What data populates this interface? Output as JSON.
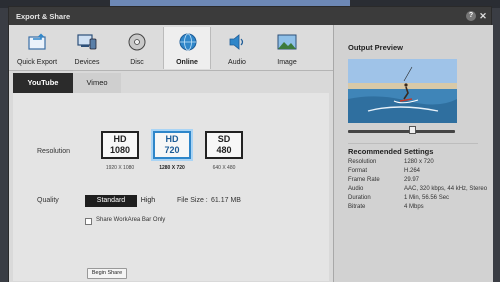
{
  "window": {
    "title": "Export & Share"
  },
  "titlebar": {
    "help_icon": "?",
    "close_icon": "✕"
  },
  "categories": [
    {
      "label": "Quick Export",
      "icon": "export-icon"
    },
    {
      "label": "Devices",
      "icon": "devices-icon"
    },
    {
      "label": "Disc",
      "icon": "disc-icon"
    },
    {
      "label": "Online",
      "icon": "globe-icon",
      "active": true
    },
    {
      "label": "Audio",
      "icon": "speaker-icon"
    },
    {
      "label": "Image",
      "icon": "image-icon"
    }
  ],
  "subtabs": [
    {
      "label": "YouTube",
      "active": true
    },
    {
      "label": "Vimeo"
    }
  ],
  "resolution": {
    "label": "Resolution",
    "options": [
      {
        "line1": "HD",
        "line2": "1080",
        "caption": "1920 X 1080"
      },
      {
        "line1": "HD",
        "line2": "720",
        "caption": "1280 X 720",
        "selected": true
      },
      {
        "line1": "SD",
        "line2": "480",
        "caption": "640 X 480"
      }
    ]
  },
  "quality": {
    "label": "Quality",
    "options": [
      "Standard",
      "High"
    ],
    "selected": "Standard",
    "file_size_label": "File Size :",
    "file_size_value": "61.17 MB"
  },
  "share_workarea": {
    "label": "Share WorkArea Bar Only",
    "checked": false
  },
  "begin_share": {
    "label": "Begin Share"
  },
  "output_preview": {
    "title": "Output Preview",
    "slider_position": 0.6
  },
  "recommended": {
    "title": "Recommended Settings",
    "rows": [
      {
        "key": "Resolution",
        "value": "1280 x 720"
      },
      {
        "key": "Format",
        "value": "H.264"
      },
      {
        "key": "Frame Rate",
        "value": "29.97"
      },
      {
        "key": "Audio",
        "value": "AAC, 320 kbps, 44 kHz, Stereo"
      },
      {
        "key": "Duration",
        "value": "1 Min, 56.56 Sec"
      },
      {
        "key": "Bitrate",
        "value": "4 Mbps"
      }
    ]
  },
  "colors": {
    "accent": "#2f86c9",
    "titlebar": "#3b3b3b",
    "active_subtab": "#2b2b2b"
  }
}
